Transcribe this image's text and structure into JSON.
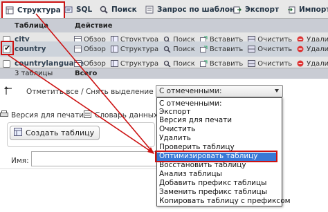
{
  "tabs": [
    {
      "label": "Структура",
      "icon": "structure-icon"
    },
    {
      "label": "SQL",
      "icon": "sql-icon"
    },
    {
      "label": "Поиск",
      "icon": "search-icon"
    },
    {
      "label": "Запрос по шаблону",
      "icon": "query-icon"
    },
    {
      "label": "Экспорт",
      "icon": "export-icon"
    },
    {
      "label": "Импорт",
      "icon": "import-icon"
    }
  ],
  "table": {
    "col_table": "Таблица",
    "col_action": "Действие",
    "actions": [
      "Обзор",
      "Структура",
      "Поиск",
      "Вставить",
      "Очистить",
      "Удалить"
    ],
    "rows": [
      {
        "name": "city",
        "checked": false
      },
      {
        "name": "country",
        "checked": true
      },
      {
        "name": "countrylanguage",
        "checked": false
      }
    ],
    "footer_count": "3 таблицы",
    "footer_total": "Всего"
  },
  "bulk": {
    "mark_all": "Отметить все / Снять выделение",
    "select_value": "С отмеченными:"
  },
  "links": {
    "print": "Версия для печати",
    "dictionary": "Словарь данных"
  },
  "create": {
    "button": "Создать таблицу",
    "name_label": "Имя:"
  },
  "dropdown_options": [
    "С отмеченными:",
    "Экспорт",
    "Версия для печати",
    "Очистить",
    "Удалить",
    "Проверить таблицу",
    "Оптимизировать таблицу",
    "Восстановить таблицу",
    "Анализ таблицы",
    "Добавить префикс таблицы",
    "Заменить префикс таблицы",
    "Копировать таблицу с префиксом"
  ],
  "selected_option": "Оптимизировать таблицу",
  "colors": {
    "highlight_red": "#cc1111",
    "selection_blue": "#3878d6"
  }
}
